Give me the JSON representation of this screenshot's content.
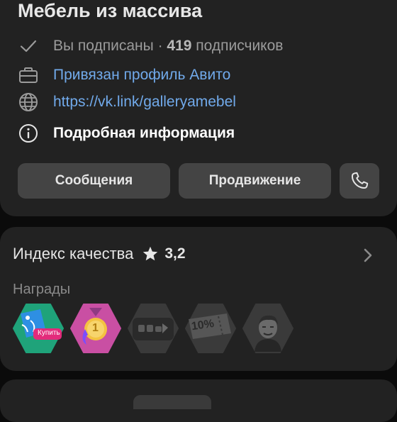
{
  "profile": {
    "title": "Мебель из массива",
    "subscribed_text": "Вы подписаны · ",
    "subscribers_count": "419",
    "subscribers_suffix": " подписчиков",
    "avito_text": "Привязан профиль Авито",
    "link_text": "https://vk.link/galleryamebel",
    "details_text": "Подробная информация"
  },
  "actions": {
    "messages_label": "Сообщения",
    "promotion_label": "Продвижение"
  },
  "quality": {
    "label": "Индекс качества",
    "rating": "3,2"
  },
  "awards": {
    "label": "Награды",
    "badge1_text": "Купить",
    "badge2_text": "1",
    "badge4_text": "10%"
  },
  "colors": {
    "accent_link": "#71aaeb",
    "card_bg": "#222222",
    "button_bg": "#444444"
  },
  "icons": [
    "check-icon",
    "briefcase-icon",
    "globe-icon",
    "info-icon",
    "phone-icon",
    "star-icon",
    "chevron-right-icon"
  ]
}
